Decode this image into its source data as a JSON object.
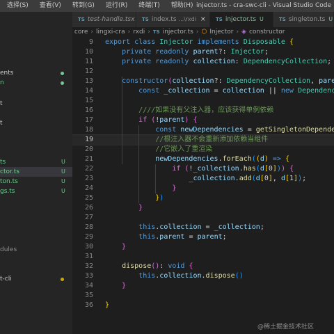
{
  "menu": [
    "选择(S)",
    "查看(V)",
    "转到(G)",
    "运行(R)",
    "终端(T)",
    "帮助(H)"
  ],
  "window_title": "injector.ts - cra-swc-cli - Visual Studio Code",
  "sidebar": {
    "items": [
      {
        "label": "ents",
        "color": "#cccccc",
        "dot": "#73c991"
      },
      {
        "label": "n",
        "color": "#73c991",
        "dot": "#73c991"
      },
      {
        "label": "t",
        "color": "#cccccc"
      },
      {
        "label": "t",
        "color": "#cccccc"
      },
      {
        "label": "ts",
        "color": "#73c991",
        "badge": "U",
        "badge_color": "#73c991"
      },
      {
        "label": "ctor.ts",
        "color": "#73c991",
        "badge": "U",
        "badge_color": "#73c991",
        "selected": true
      },
      {
        "label": "ton.ts",
        "color": "#73c991",
        "badge": "U",
        "badge_color": "#73c991"
      },
      {
        "label": "gs.ts",
        "color": "#73c991",
        "badge": "U",
        "badge_color": "#73c991"
      },
      {
        "label": "dules",
        "color": "#8c8c8c"
      },
      {
        "label": "t-cli",
        "color": "#cccccc",
        "dot": "#cca700"
      }
    ]
  },
  "tabs": [
    {
      "ts": "TS",
      "name": "test-handle.tsx",
      "italic": true
    },
    {
      "ts": "TS",
      "name": "index.ts",
      "desc": "...\\rxdi",
      "close": "×"
    },
    {
      "ts": "TS",
      "name": "injector.ts",
      "status": "U",
      "active": true
    },
    {
      "ts": "TS",
      "name": "singleton.ts",
      "status": "U"
    }
  ],
  "breadcrumb": {
    "path": [
      "core",
      "lingxi-cra",
      "rxdi"
    ],
    "file_icon": "TS",
    "file": "injector.ts",
    "class": "Injector",
    "method": "constructor"
  },
  "editor": {
    "current_line": 19,
    "lines": [
      {
        "n": "9",
        "tokens": [
          [
            "k",
            "export "
          ],
          [
            "k",
            "class "
          ],
          [
            "t",
            "Injector "
          ],
          [
            "k",
            "implements "
          ],
          [
            "t",
            "Disposable "
          ],
          [
            "b1",
            "{"
          ]
        ]
      },
      {
        "n": "10",
        "tokens": [
          [
            "p",
            "    "
          ],
          [
            "k",
            "private "
          ],
          [
            "k",
            "readonly "
          ],
          [
            "v",
            "parent"
          ],
          [
            "p",
            "?: "
          ],
          [
            "t",
            "Injector"
          ],
          [
            "p",
            ";"
          ]
        ]
      },
      {
        "n": "11",
        "tokens": [
          [
            "p",
            "    "
          ],
          [
            "k",
            "private "
          ],
          [
            "k",
            "readonly "
          ],
          [
            "v",
            "collection"
          ],
          [
            "p",
            ": "
          ],
          [
            "t",
            "DependencyCollection"
          ],
          [
            "p",
            ";"
          ]
        ]
      },
      {
        "n": "12",
        "tokens": []
      },
      {
        "n": "13",
        "tokens": [
          [
            "p",
            "    "
          ],
          [
            "k",
            "constructor"
          ],
          [
            "b2",
            "("
          ],
          [
            "v",
            "collection"
          ],
          [
            "p",
            "?: "
          ],
          [
            "t",
            "DependencyCollection"
          ],
          [
            "p",
            ", "
          ],
          [
            "v",
            "parent"
          ],
          [
            "p",
            "?"
          ]
        ]
      },
      {
        "n": "14",
        "tokens": [
          [
            "p",
            "        "
          ],
          [
            "k",
            "const "
          ],
          [
            "v",
            "_collection "
          ],
          [
            "p",
            "= "
          ],
          [
            "v",
            "collection "
          ],
          [
            "p",
            "|| "
          ],
          [
            "k",
            "new "
          ],
          [
            "t",
            "DependencyCo"
          ]
        ]
      },
      {
        "n": "15",
        "tokens": []
      },
      {
        "n": "16",
        "tokens": [
          [
            "p",
            "        "
          ],
          [
            "m",
            "////如果没有父注入器，应该获得单例依赖"
          ]
        ]
      },
      {
        "n": "17",
        "tokens": [
          [
            "p",
            "        "
          ],
          [
            "c",
            "if "
          ],
          [
            "b2",
            "("
          ],
          [
            "p",
            "!"
          ],
          [
            "v",
            "parent"
          ],
          [
            "b2",
            ")"
          ],
          [
            "p",
            " "
          ],
          [
            "b2",
            "{"
          ]
        ]
      },
      {
        "n": "18",
        "tokens": [
          [
            "p",
            "            "
          ],
          [
            "k",
            "const "
          ],
          [
            "v",
            "newDependencies "
          ],
          [
            "p",
            "= "
          ],
          [
            "f",
            "getSingletonDependenci"
          ]
        ]
      },
      {
        "n": "19",
        "tokens": [
          [
            "p",
            "            "
          ],
          [
            "m",
            "//根注入器不会重新添加依赖当组件"
          ]
        ]
      },
      {
        "n": "20",
        "tokens": [
          [
            "p",
            "            "
          ],
          [
            "m",
            "//它嵌入了重渲染"
          ]
        ]
      },
      {
        "n": "21",
        "tokens": [
          [
            "p",
            "            "
          ],
          [
            "v",
            "newDependencies"
          ],
          [
            "p",
            "."
          ],
          [
            "f",
            "forEach"
          ],
          [
            "b3",
            "("
          ],
          [
            "b1",
            "("
          ],
          [
            "v",
            "d"
          ],
          [
            "b1",
            ")"
          ],
          [
            "p",
            " "
          ],
          [
            "k",
            "=> "
          ],
          [
            "b1",
            "{"
          ]
        ]
      },
      {
        "n": "22",
        "tokens": [
          [
            "p",
            "                "
          ],
          [
            "c",
            "if "
          ],
          [
            "b2",
            "("
          ],
          [
            "p",
            "!"
          ],
          [
            "v",
            "_collection"
          ],
          [
            "p",
            "."
          ],
          [
            "f",
            "has"
          ],
          [
            "b3",
            "("
          ],
          [
            "v",
            "d"
          ],
          [
            "b1",
            "["
          ],
          [
            "p",
            "0"
          ],
          [
            "b1",
            "]"
          ],
          [
            "b3",
            ")"
          ],
          [
            "b2",
            ")"
          ],
          [
            "p",
            " "
          ],
          [
            "b2",
            "{"
          ]
        ]
      },
      {
        "n": "23",
        "tokens": [
          [
            "p",
            "                    "
          ],
          [
            "v",
            "_collection"
          ],
          [
            "p",
            "."
          ],
          [
            "f",
            "add"
          ],
          [
            "b3",
            "("
          ],
          [
            "v",
            "d"
          ],
          [
            "b1",
            "["
          ],
          [
            "p",
            "0"
          ],
          [
            "b1",
            "]"
          ],
          [
            "p",
            ", "
          ],
          [
            "v",
            "d"
          ],
          [
            "b1",
            "["
          ],
          [
            "p",
            "1"
          ],
          [
            "b1",
            "]"
          ],
          [
            "b3",
            ")"
          ],
          [
            "p",
            ";"
          ]
        ]
      },
      {
        "n": "24",
        "tokens": [
          [
            "p",
            "                "
          ],
          [
            "b2",
            "}"
          ]
        ]
      },
      {
        "n": "25",
        "tokens": [
          [
            "p",
            "            "
          ],
          [
            "b1",
            "}"
          ],
          [
            "b3",
            ")"
          ]
        ]
      },
      {
        "n": "26",
        "tokens": [
          [
            "p",
            "        "
          ],
          [
            "b2",
            "}"
          ]
        ]
      },
      {
        "n": "27",
        "tokens": []
      },
      {
        "n": "28",
        "tokens": [
          [
            "p",
            "        "
          ],
          [
            "k",
            "this"
          ],
          [
            "p",
            "."
          ],
          [
            "v",
            "collection "
          ],
          [
            "p",
            "= "
          ],
          [
            "v",
            "_collection"
          ],
          [
            "p",
            ";"
          ]
        ]
      },
      {
        "n": "29",
        "tokens": [
          [
            "p",
            "        "
          ],
          [
            "k",
            "this"
          ],
          [
            "p",
            "."
          ],
          [
            "v",
            "parent "
          ],
          [
            "p",
            "= "
          ],
          [
            "v",
            "parent"
          ],
          [
            "p",
            ";"
          ]
        ]
      },
      {
        "n": "30",
        "tokens": [
          [
            "p",
            "    "
          ],
          [
            "b2",
            "}"
          ]
        ]
      },
      {
        "n": "31",
        "tokens": []
      },
      {
        "n": "32",
        "tokens": [
          [
            "p",
            "    "
          ],
          [
            "f",
            "dispose"
          ],
          [
            "b2",
            "("
          ],
          [
            "b2",
            ")"
          ],
          [
            "p",
            ": "
          ],
          [
            "k",
            "void "
          ],
          [
            "b2",
            "{"
          ]
        ]
      },
      {
        "n": "33",
        "tokens": [
          [
            "p",
            "        "
          ],
          [
            "k",
            "this"
          ],
          [
            "p",
            "."
          ],
          [
            "v",
            "collection"
          ],
          [
            "p",
            "."
          ],
          [
            "f",
            "dispose"
          ],
          [
            "b3",
            "("
          ],
          [
            "b3",
            ")"
          ]
        ]
      },
      {
        "n": "34",
        "tokens": [
          [
            "p",
            "    "
          ],
          [
            "b2",
            "}"
          ]
        ]
      },
      {
        "n": "35",
        "tokens": []
      },
      {
        "n": "36",
        "tokens": [
          [
            "b1",
            "}"
          ]
        ]
      }
    ]
  },
  "watermark": "@稀土掘金技术社区"
}
